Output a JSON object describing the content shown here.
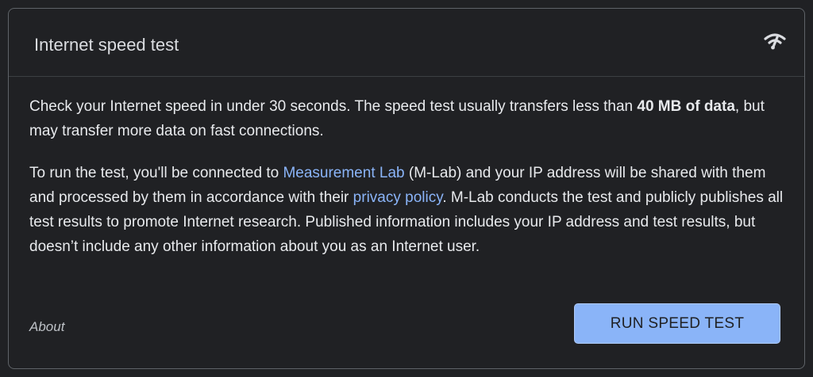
{
  "card": {
    "title": "Internet speed test",
    "icon": "wifi-speed-icon"
  },
  "body": {
    "p1": {
      "text_a": "Check your Internet speed in under 30 seconds. The speed test usually transfers less than ",
      "bold": "40 MB of data",
      "text_b": ", but may transfer more data on fast connections."
    },
    "p2": {
      "text_a": "To run the test, you'll be connected to ",
      "link1": "Measurement Lab",
      "text_b": " (M-Lab) and your IP address will be shared with them and processed by them in accordance with their ",
      "link2": "privacy policy",
      "text_c": ". M-Lab conducts the test and publicly publishes all test results to promote Internet research. Published information includes your IP address and test results, but doesn’t include any other information about you as an Internet user."
    }
  },
  "footer": {
    "about_label": "About",
    "run_button_label": "RUN SPEED TEST"
  },
  "colors": {
    "background": "#202124",
    "border": "#5f6368",
    "text": "#e8eaed",
    "link": "#8ab4f8",
    "button": "#8ab4f8"
  }
}
